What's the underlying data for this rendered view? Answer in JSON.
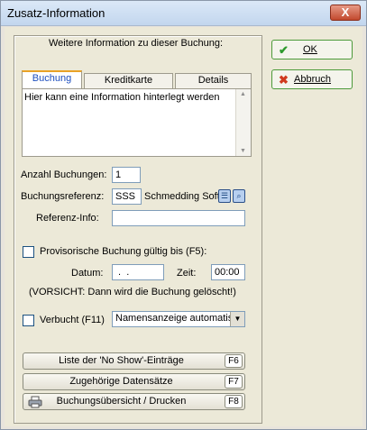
{
  "window": {
    "title": "Zusatz-Information",
    "close_glyph": "X"
  },
  "header": "Weitere Information zu dieser Buchung:",
  "tabs": [
    {
      "label": "Buchung",
      "active": true
    },
    {
      "label": "Kreditkarte",
      "active": false
    },
    {
      "label": "Details",
      "active": false
    }
  ],
  "info_text": "Hier kann eine Information hinterlegt werden",
  "form": {
    "anzahl_label": "Anzahl Buchungen:",
    "anzahl_value": "1",
    "referenz_label": "Buchungsreferenz:",
    "referenz_value": "SSS",
    "referenz_company": "Schmedding Soft",
    "referenzinfo_label": "Referenz-Info:",
    "referenzinfo_value": "",
    "provisorisch_label": "Provisorische Buchung gültig bis (F5):",
    "datum_label": "Datum:",
    "datum_value": " .  .",
    "zeit_label": "Zeit:",
    "zeit_value": "00:00",
    "warning": "(VORSICHT: Dann wird die Buchung gelöscht!)",
    "verbucht_label": "Verbucht (F11)",
    "namensanzeige_value": "Namensanzeige automatisch"
  },
  "actions": [
    {
      "label": "Liste der 'No Show'-Einträge",
      "key": "F6"
    },
    {
      "label": "Zugehörige Datensätze",
      "key": "F7"
    },
    {
      "label": "Buchungsübersicht / Drucken",
      "key": "F8"
    }
  ],
  "buttons": {
    "ok": "OK",
    "cancel": "Abbruch"
  },
  "icons": {
    "ok": "check-icon",
    "cancel": "x-icon",
    "print": "printer-icon"
  },
  "colors": {
    "ok_check": "#2e9a2e",
    "cancel_x": "#d03a1e",
    "active_tab": "#1e4fbf"
  }
}
